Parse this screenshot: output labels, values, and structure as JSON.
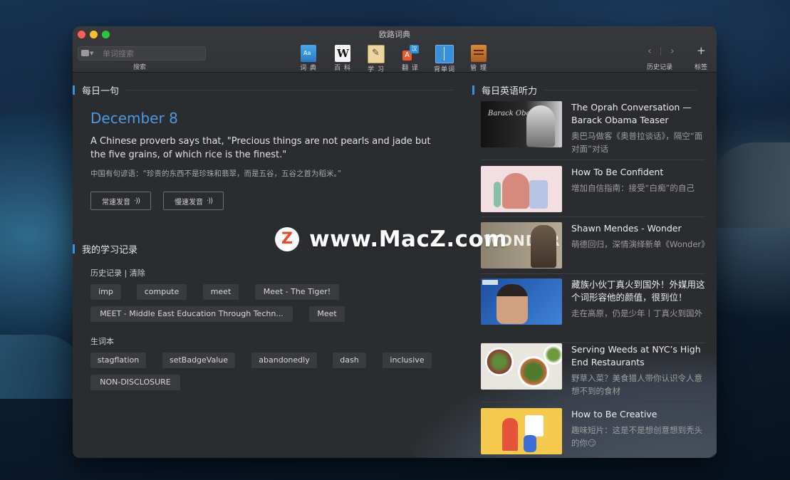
{
  "window": {
    "title": "欧路词典"
  },
  "toolbar": {
    "search_placeholder": "单词搜索",
    "search_caption": "搜索",
    "tools": [
      {
        "label": "词 典",
        "icon": "dictionary-icon"
      },
      {
        "label": "百 科",
        "icon": "wikipedia-icon"
      },
      {
        "label": "学 习",
        "icon": "study-icon"
      },
      {
        "label": "翻 译",
        "icon": "translate-icon"
      },
      {
        "label": "背单词",
        "icon": "vocabulary-icon"
      },
      {
        "label": "管 理",
        "icon": "manage-icon"
      }
    ],
    "back": "‹",
    "forward": "›",
    "history_caption": "历史记录",
    "add": "+",
    "tags_caption": "标签"
  },
  "daily": {
    "heading": "每日一句",
    "date": "December 8",
    "quote_en": "A Chinese proverb says that, \"Precious things are not pearls and jade but the five grains, of which rice is the finest.\"",
    "quote_cn": "中国有句谚语：“珍贵的东西不是珍珠和翡翠，而是五谷，五谷之首为稻米。”",
    "normal_speed": "常速发音",
    "slow_speed": "慢速发音",
    "sound_glyph": "·))"
  },
  "records": {
    "heading": "我的学习记录",
    "history_caption": "历史记录 | 清除",
    "history": [
      "imp",
      "compute",
      "meet",
      "Meet - The Tiger!",
      "MEET - Middle East Education Through Techn...",
      "Meet"
    ],
    "vocab_caption": "生词本",
    "vocab": [
      "stagflation",
      "setBadgeValue",
      "abandonedly",
      "dash",
      "inclusive",
      "NON-DISCLOSURE"
    ]
  },
  "listening": {
    "heading": "每日英语听力",
    "items": [
      {
        "title": "The Oprah Conversation — Barack Obama Teaser",
        "sub": "奥巴马做客《奥普拉谈话》，隔空“面对面”对话",
        "thumb_text": "Barack Obama"
      },
      {
        "title": "How To Be Confident",
        "sub": "增加自信指南：接受“白痴”的自己"
      },
      {
        "title": "Shawn Mendes - Wonder",
        "sub": "萌德回归，深情演绎新单《Wonder》",
        "thumb_text": "WONDER"
      },
      {
        "title": "藏族小伙丁真火到国外！外媒用这个词形容他的颜值，很到位！",
        "sub": "走在高原，仍是少年丨丁真火到国外"
      },
      {
        "title": "Serving Weeds at NYC’s High End Restaurants",
        "sub": "野草入菜？美食猎人带你认识令人意想不到的食材"
      },
      {
        "title": "How to Be Creative",
        "sub": "趣味短片：这是不是想创意想到秃头的你😏"
      }
    ]
  },
  "watermark": {
    "logo": "Z",
    "text": "www.MacZ.com"
  },
  "colors": {
    "accent": "#3f8fe0",
    "date": "#4b9ae6",
    "window_bg": "#2b2c2f"
  }
}
